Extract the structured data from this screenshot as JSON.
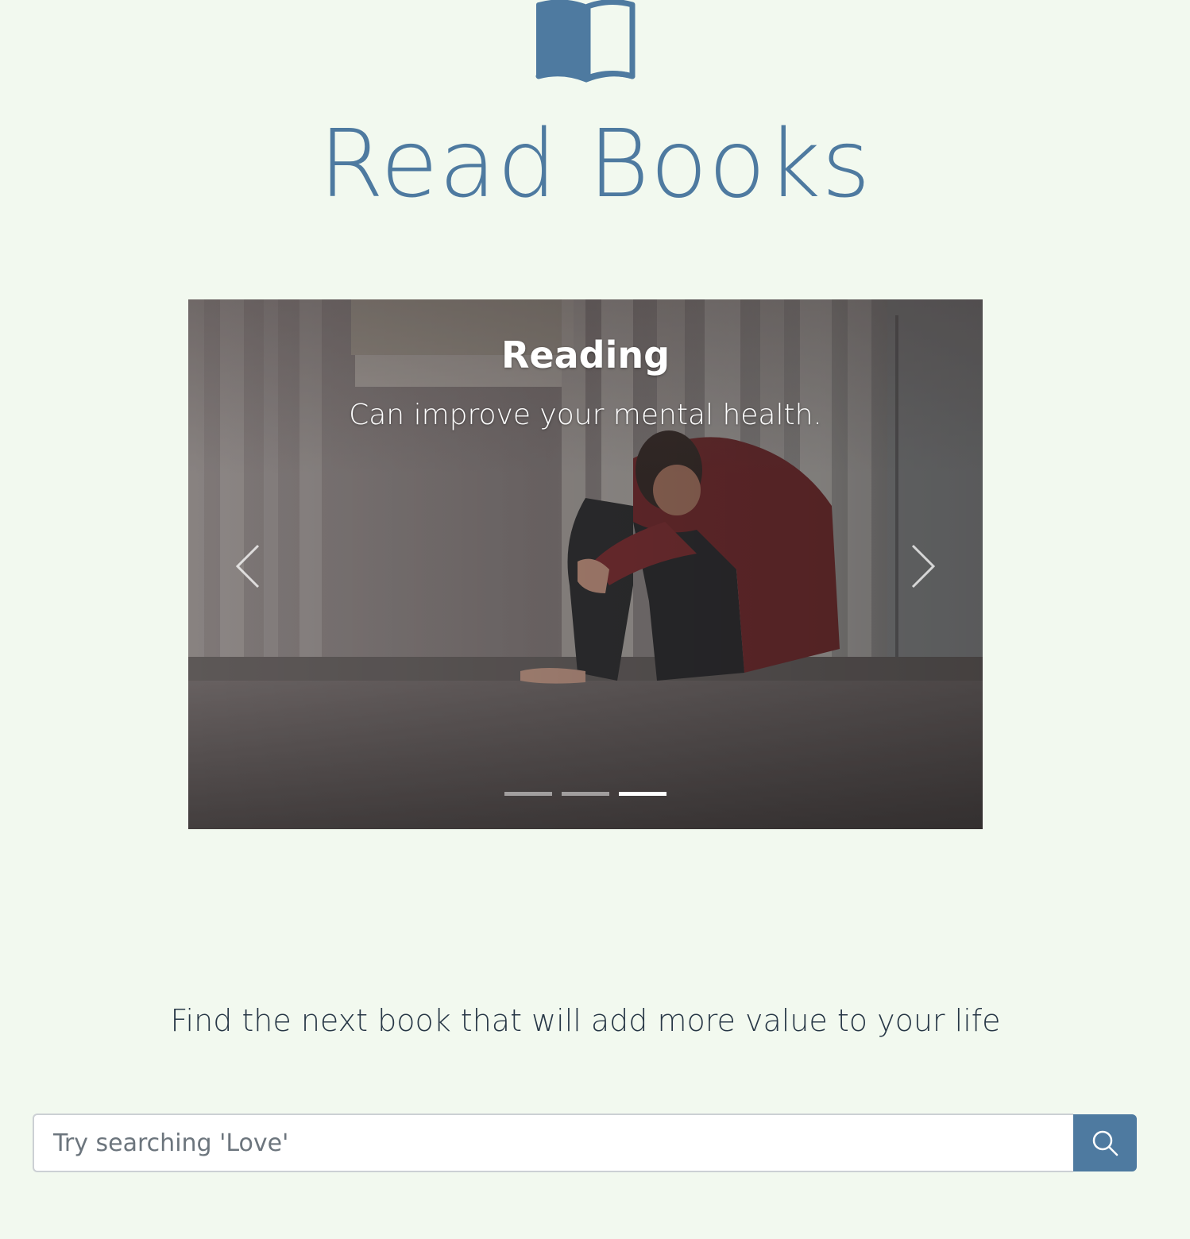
{
  "brand": {
    "title": "Read Books",
    "icon": "open-book-icon",
    "color": "#4e7aa0"
  },
  "carousel": {
    "slide_caption": {
      "title": "Reading",
      "text": "Can improve your mental health."
    },
    "slide_count": 3,
    "active_index": 2,
    "controls": {
      "prev_icon": "chevron-left-icon",
      "next_icon": "chevron-right-icon"
    }
  },
  "tagline": "Find the next book that will add more value to your life",
  "search": {
    "placeholder": "Try searching 'Love'",
    "value": "",
    "button_icon": "search-icon"
  },
  "colors": {
    "background": "#f2f9ef",
    "accent": "#4e7aa0",
    "text": "#273746"
  }
}
